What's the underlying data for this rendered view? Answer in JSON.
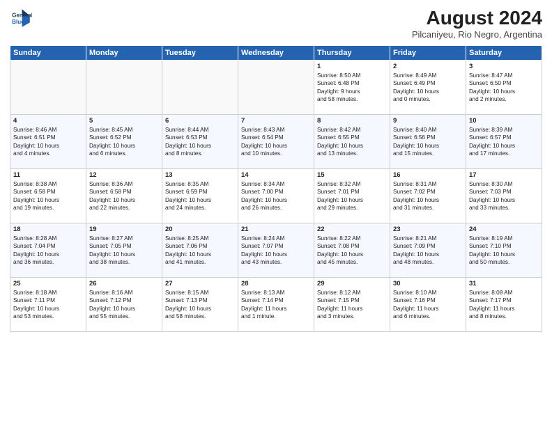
{
  "header": {
    "logo_line1": "General",
    "logo_line2": "Blue",
    "title": "August 2024",
    "subtitle": "Pilcaniyeu, Rio Negro, Argentina"
  },
  "days_of_week": [
    "Sunday",
    "Monday",
    "Tuesday",
    "Wednesday",
    "Thursday",
    "Friday",
    "Saturday"
  ],
  "weeks": [
    [
      {
        "day": "",
        "info": ""
      },
      {
        "day": "",
        "info": ""
      },
      {
        "day": "",
        "info": ""
      },
      {
        "day": "",
        "info": ""
      },
      {
        "day": "1",
        "info": "Sunrise: 8:50 AM\nSunset: 6:48 PM\nDaylight: 9 hours\nand 58 minutes."
      },
      {
        "day": "2",
        "info": "Sunrise: 8:49 AM\nSunset: 6:49 PM\nDaylight: 10 hours\nand 0 minutes."
      },
      {
        "day": "3",
        "info": "Sunrise: 8:47 AM\nSunset: 6:50 PM\nDaylight: 10 hours\nand 2 minutes."
      }
    ],
    [
      {
        "day": "4",
        "info": "Sunrise: 8:46 AM\nSunset: 6:51 PM\nDaylight: 10 hours\nand 4 minutes."
      },
      {
        "day": "5",
        "info": "Sunrise: 8:45 AM\nSunset: 6:52 PM\nDaylight: 10 hours\nand 6 minutes."
      },
      {
        "day": "6",
        "info": "Sunrise: 8:44 AM\nSunset: 6:53 PM\nDaylight: 10 hours\nand 8 minutes."
      },
      {
        "day": "7",
        "info": "Sunrise: 8:43 AM\nSunset: 6:54 PM\nDaylight: 10 hours\nand 10 minutes."
      },
      {
        "day": "8",
        "info": "Sunrise: 8:42 AM\nSunset: 6:55 PM\nDaylight: 10 hours\nand 13 minutes."
      },
      {
        "day": "9",
        "info": "Sunrise: 8:40 AM\nSunset: 6:56 PM\nDaylight: 10 hours\nand 15 minutes."
      },
      {
        "day": "10",
        "info": "Sunrise: 8:39 AM\nSunset: 6:57 PM\nDaylight: 10 hours\nand 17 minutes."
      }
    ],
    [
      {
        "day": "11",
        "info": "Sunrise: 8:38 AM\nSunset: 6:58 PM\nDaylight: 10 hours\nand 19 minutes."
      },
      {
        "day": "12",
        "info": "Sunrise: 8:36 AM\nSunset: 6:58 PM\nDaylight: 10 hours\nand 22 minutes."
      },
      {
        "day": "13",
        "info": "Sunrise: 8:35 AM\nSunset: 6:59 PM\nDaylight: 10 hours\nand 24 minutes."
      },
      {
        "day": "14",
        "info": "Sunrise: 8:34 AM\nSunset: 7:00 PM\nDaylight: 10 hours\nand 26 minutes."
      },
      {
        "day": "15",
        "info": "Sunrise: 8:32 AM\nSunset: 7:01 PM\nDaylight: 10 hours\nand 29 minutes."
      },
      {
        "day": "16",
        "info": "Sunrise: 8:31 AM\nSunset: 7:02 PM\nDaylight: 10 hours\nand 31 minutes."
      },
      {
        "day": "17",
        "info": "Sunrise: 8:30 AM\nSunset: 7:03 PM\nDaylight: 10 hours\nand 33 minutes."
      }
    ],
    [
      {
        "day": "18",
        "info": "Sunrise: 8:28 AM\nSunset: 7:04 PM\nDaylight: 10 hours\nand 36 minutes."
      },
      {
        "day": "19",
        "info": "Sunrise: 8:27 AM\nSunset: 7:05 PM\nDaylight: 10 hours\nand 38 minutes."
      },
      {
        "day": "20",
        "info": "Sunrise: 8:25 AM\nSunset: 7:06 PM\nDaylight: 10 hours\nand 41 minutes."
      },
      {
        "day": "21",
        "info": "Sunrise: 8:24 AM\nSunset: 7:07 PM\nDaylight: 10 hours\nand 43 minutes."
      },
      {
        "day": "22",
        "info": "Sunrise: 8:22 AM\nSunset: 7:08 PM\nDaylight: 10 hours\nand 45 minutes."
      },
      {
        "day": "23",
        "info": "Sunrise: 8:21 AM\nSunset: 7:09 PM\nDaylight: 10 hours\nand 48 minutes."
      },
      {
        "day": "24",
        "info": "Sunrise: 8:19 AM\nSunset: 7:10 PM\nDaylight: 10 hours\nand 50 minutes."
      }
    ],
    [
      {
        "day": "25",
        "info": "Sunrise: 8:18 AM\nSunset: 7:11 PM\nDaylight: 10 hours\nand 53 minutes."
      },
      {
        "day": "26",
        "info": "Sunrise: 8:16 AM\nSunset: 7:12 PM\nDaylight: 10 hours\nand 55 minutes."
      },
      {
        "day": "27",
        "info": "Sunrise: 8:15 AM\nSunset: 7:13 PM\nDaylight: 10 hours\nand 58 minutes."
      },
      {
        "day": "28",
        "info": "Sunrise: 8:13 AM\nSunset: 7:14 PM\nDaylight: 11 hours\nand 1 minute."
      },
      {
        "day": "29",
        "info": "Sunrise: 8:12 AM\nSunset: 7:15 PM\nDaylight: 11 hours\nand 3 minutes."
      },
      {
        "day": "30",
        "info": "Sunrise: 8:10 AM\nSunset: 7:16 PM\nDaylight: 11 hours\nand 6 minutes."
      },
      {
        "day": "31",
        "info": "Sunrise: 8:08 AM\nSunset: 7:17 PM\nDaylight: 11 hours\nand 8 minutes."
      }
    ]
  ]
}
